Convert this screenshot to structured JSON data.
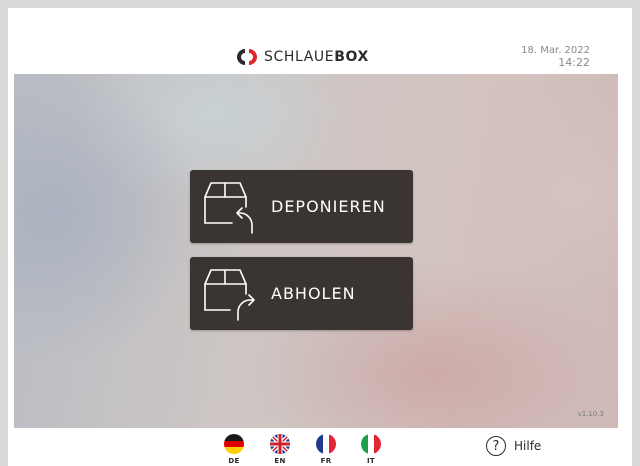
{
  "header": {
    "brand_light": "SCHLAUE",
    "brand_bold": "BOX",
    "date": "18. Mar. 2022",
    "time": "14:22"
  },
  "actions": {
    "deposit_label": "DEPONIEREN",
    "pickup_label": "ABHOLEN"
  },
  "version": "v1.10.3",
  "languages": [
    {
      "code": "DE",
      "icon": "flag-de-icon"
    },
    {
      "code": "EN",
      "icon": "flag-en-icon"
    },
    {
      "code": "FR",
      "icon": "flag-fr-icon"
    },
    {
      "code": "IT",
      "icon": "flag-it-icon"
    }
  ],
  "help": {
    "label": "Hilfe",
    "icon": "help-icon"
  },
  "colors": {
    "button_bg": "#3a3533",
    "brand_red": "#e3242b",
    "text_dark": "#2b2b2b"
  }
}
